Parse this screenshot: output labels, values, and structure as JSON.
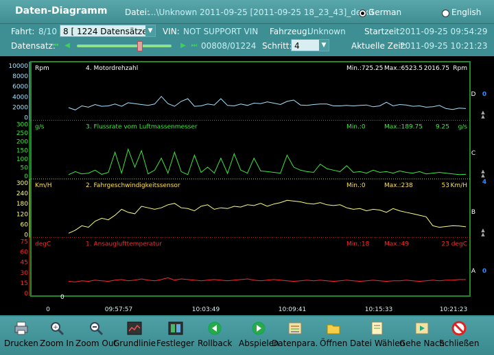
{
  "window": {
    "title": "Daten-Diagramm"
  },
  "header": {
    "datei_label": "Datei:",
    "datei_value": "...\\Unknown 2011-09-25 [2011-09-25 18_23_43]_de.x3",
    "lang_german": "German",
    "lang_english": "English",
    "fahrt_label": "Fahrt:",
    "fahrt_value": "8/10",
    "fahrt_select": "8 [ 1224 Datensätze]",
    "vin_label": "VIN:",
    "vin_value": "NOT SUPPORT VIN",
    "fahrzeug_label": "Fahrzeug:",
    "fahrzeug_value": "Unknown",
    "startzeit_label": "Startzeit:",
    "startzeit_value": "2011-09-25 09:54:29",
    "datensatz_label": "Datensatz:",
    "datensatz_value": "00808/01224",
    "slider_position": 0.66,
    "schritt_label": "Schritt:",
    "schritt_value": "4",
    "aktuelle_label": "Aktuelle Zeit:",
    "aktuelle_value": "2011-09-25 10:21:23"
  },
  "chart_data": {
    "type": "line",
    "x_ticks": [
      "0",
      "09:57:57",
      "10:03:49",
      "10:09:41",
      "10:15:33",
      "10:21:23"
    ],
    "zero_label": "0",
    "side_labels": [
      "D",
      "C",
      "B",
      "A"
    ],
    "side_values": [
      "0",
      "4",
      "0"
    ],
    "panels": [
      {
        "id": "D",
        "unit": "Rpm",
        "name": "4. Motordrehzahl",
        "min": "Min.:725.25",
        "max": "Max.:6523.5",
        "current": "2016.75",
        "cur_unit": "Rpm",
        "color": "#a8e4ff",
        "label_color": "#ffffff",
        "ticks": [
          "10000",
          "8000",
          "6000",
          "4000",
          "2000",
          "0"
        ],
        "ylim": [
          0,
          10000
        ],
        "values": [
          2200,
          1700,
          2600,
          2300,
          2900,
          2500,
          2600,
          3000,
          2500,
          3300,
          3100,
          2900,
          2700,
          3000,
          4700,
          3100,
          2500,
          3600,
          4200,
          2500,
          2600,
          3000,
          2800,
          4200,
          2700,
          2600,
          3000,
          2700,
          3200,
          3100,
          3500,
          3200,
          2900,
          3600,
          3900,
          2800,
          2700,
          2900,
          3000,
          3000,
          2600,
          2600,
          2700,
          2600,
          2700,
          2800,
          2400,
          2600,
          3400,
          2600,
          2900,
          2800,
          2500,
          2600,
          2300,
          2400,
          2700,
          2000,
          1800,
          2100,
          2000
        ]
      },
      {
        "id": "C",
        "unit": "g/s",
        "name": "3. Flussrate vom Luftmassenmesser",
        "min": "Min.:0",
        "max": "Max.:189.75",
        "current": "9.25",
        "cur_unit": "g/s",
        "color": "#3ee83e",
        "label_color": "#3ee83e",
        "ticks": [
          "300",
          "250",
          "200",
          "150",
          "100",
          "50",
          "0"
        ],
        "ylim": [
          0,
          300
        ],
        "values": [
          10,
          30,
          15,
          20,
          40,
          12,
          25,
          160,
          20,
          180,
          60,
          170,
          15,
          40,
          120,
          20,
          160,
          30,
          10,
          140,
          25,
          60,
          20,
          120,
          18,
          150,
          40,
          20,
          120,
          35,
          30,
          25,
          20,
          140,
          60,
          40,
          30,
          25,
          80,
          50,
          40,
          30,
          70,
          25,
          30,
          20,
          40,
          25,
          30,
          20,
          35,
          25,
          20,
          30,
          15,
          20,
          25,
          20,
          15,
          10,
          12
        ]
      },
      {
        "id": "B",
        "unit": "Km/H",
        "name": "2. Fahrgeschwindigkeitssensor",
        "min": "Min.:0",
        "max": "Max.:238",
        "current": "53",
        "cur_unit": "Km/H",
        "color": "#ffff7a",
        "label_color": "#ffe24a",
        "ticks": [
          "300",
          "240",
          "180",
          "120",
          "60",
          "0"
        ],
        "ylim": [
          0,
          300
        ],
        "values": [
          10,
          30,
          60,
          50,
          90,
          110,
          100,
          130,
          170,
          150,
          140,
          190,
          180,
          170,
          180,
          200,
          210,
          180,
          175,
          160,
          190,
          200,
          170,
          180,
          175,
          190,
          185,
          200,
          195,
          210,
          190,
          205,
          215,
          230,
          225,
          220,
          210,
          205,
          215,
          200,
          195,
          200,
          180,
          170,
          175,
          160,
          170,
          165,
          150,
          175,
          160,
          150,
          140,
          130,
          120,
          60,
          50,
          55,
          60,
          58,
          53
        ]
      },
      {
        "id": "A",
        "unit": "degC",
        "name": "1. Ansauglufttemperatur",
        "min": "Min.:18",
        "max": "Max.:49",
        "current": "23",
        "cur_unit": "degC",
        "color": "#ff2a2a",
        "label_color": "#ff2a2a",
        "ticks": [
          "75",
          "60",
          "45",
          "30",
          "15",
          "0"
        ],
        "ylim": [
          0,
          75
        ],
        "values": [
          20,
          19,
          21,
          20,
          22,
          21,
          20,
          22,
          23,
          21,
          22,
          24,
          22,
          21,
          23,
          26,
          22,
          24,
          23,
          22,
          21,
          22,
          23,
          22,
          21,
          22,
          23,
          24,
          22,
          21,
          22,
          23,
          22,
          21,
          20,
          21,
          22,
          21,
          22,
          21,
          20,
          21,
          22,
          21,
          20,
          21,
          22,
          21,
          20,
          21,
          21,
          22,
          21,
          20,
          21,
          22,
          21,
          22,
          22,
          23,
          23
        ]
      }
    ]
  },
  "toolbar": [
    {
      "id": "drucken",
      "label": "Drucken",
      "icon": "printer-icon"
    },
    {
      "id": "zoom-in",
      "label": "Zoom In",
      "icon": "zoom-in-icon"
    },
    {
      "id": "zoom-out",
      "label": "Zoom Out",
      "icon": "zoom-out-icon"
    },
    {
      "id": "grundlinie",
      "label": "Grundlinie",
      "icon": "baseline-icon"
    },
    {
      "id": "festleger",
      "label": "Festleger",
      "icon": "fix-icon"
    },
    {
      "id": "rollback",
      "label": "Rollback",
      "icon": "rollback-icon"
    },
    {
      "id": "abspielen",
      "label": "Abspielen",
      "icon": "play-icon"
    },
    {
      "id": "datenpara",
      "label": "Datenpara.",
      "icon": "data-params-icon"
    },
    {
      "id": "oeffnen",
      "label": "Öffnen",
      "icon": "folder-open-icon"
    },
    {
      "id": "datei-waehlen",
      "label": "Datei Wählen",
      "icon": "file-select-icon"
    },
    {
      "id": "gehe-nach",
      "label": "Gehe Nach",
      "icon": "goto-icon"
    },
    {
      "id": "schliessen",
      "label": "Schließen",
      "icon": "close-icon"
    }
  ]
}
